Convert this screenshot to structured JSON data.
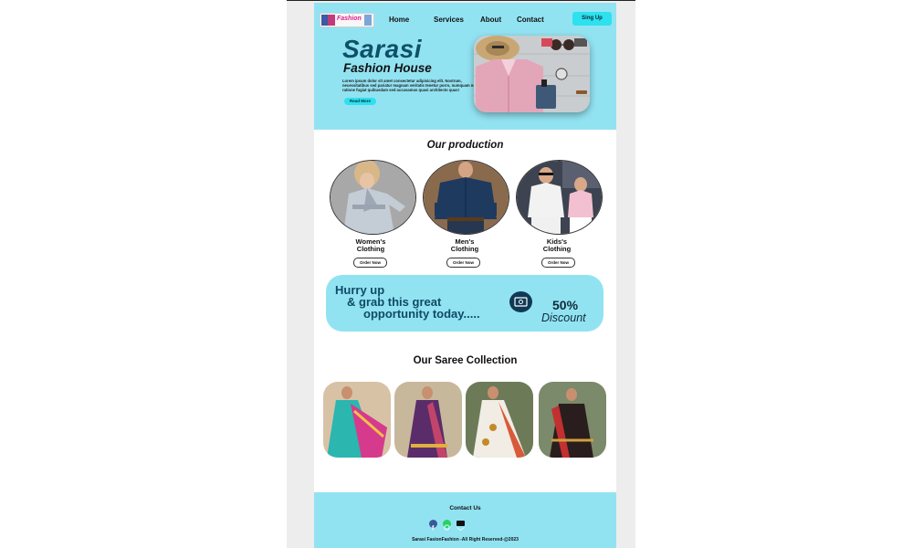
{
  "nav": {
    "logo_text": "Fashion",
    "links": [
      "Home",
      "Services",
      "About",
      "Contact"
    ],
    "signup_label": "Sing Up"
  },
  "hero": {
    "title": "Sarasi",
    "subtitle": "Fashion House",
    "body": "Lorem ipsum dolor sit amet consectetur adipisicing elit. Nostrum, necessitatibus sed pariatur magnam veritatis tenetur porro, numquam neque ratione fugiat quibusdam sed accusamus quasi architecto quas!",
    "read_more_label": "Read More"
  },
  "production": {
    "title": "Our production",
    "items": [
      {
        "label_line1": "Women's",
        "label_line2": "Clothing",
        "order_label": "Order Now"
      },
      {
        "label_line1": "Men's",
        "label_line2": "Clothing",
        "order_label": "Order Now"
      },
      {
        "label_line1": "Kids's",
        "label_line2": "Clothing",
        "order_label": "Order Now"
      }
    ]
  },
  "promo": {
    "line1": "Hurry up",
    "line2": "& grab this great",
    "line3": "opportunity today.....",
    "percent": "50%",
    "discount": "Discount"
  },
  "saree": {
    "title": "Our Saree Collection"
  },
  "footer": {
    "contact_label": "Contact Us",
    "copyright": "Sarasi FasionFashion -All Right Reserved-@2023",
    "social_icons": [
      "facebook-icon",
      "whatsapp-icon",
      "email-icon"
    ]
  },
  "colors": {
    "accent_bg": "#92e3f2",
    "button": "#2ee1ee",
    "brand_title": "#0f5069"
  }
}
